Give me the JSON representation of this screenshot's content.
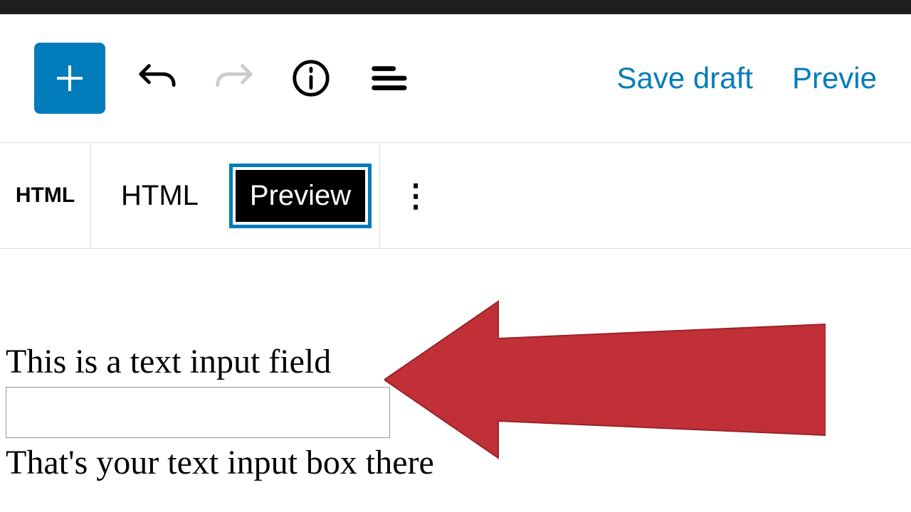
{
  "top_toolbar": {
    "save_draft_label": "Save draft",
    "preview_label": "Previe"
  },
  "block_toolbar": {
    "type_label": "HTML",
    "tabs": {
      "html_label": "HTML",
      "preview_label": "Preview"
    },
    "more_label": "⋮"
  },
  "content": {
    "heading_text": "This is a text input field",
    "input_value": "",
    "caption_text": "That's your text input box there"
  },
  "colors": {
    "accent": "#007cba",
    "arrow": "#c23037"
  }
}
